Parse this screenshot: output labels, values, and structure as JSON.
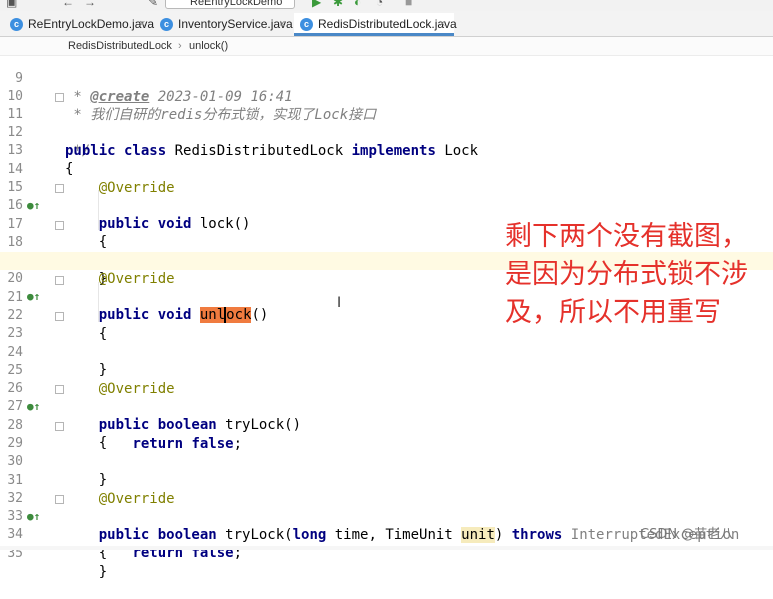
{
  "toolbar": {
    "run_config": "ReEntryLockDemo"
  },
  "tabs": [
    {
      "label": "ReEntryLockDemo.java",
      "active": false
    },
    {
      "label": "InventoryService.java",
      "active": false
    },
    {
      "label": "RedisDistributedLock.java",
      "active": true
    }
  ],
  "breadcrumb": {
    "class": "RedisDistributedLock",
    "method": "unlock()"
  },
  "annotation_note": "剩下两个没有截图，是因为分布式锁不涉及，所以不用重写",
  "watermark": "CSDN @苗老八",
  "lines": [
    {
      "n": "9",
      "text": " * @create 2023-01-09 16:41"
    },
    {
      "n": "10",
      "text": " * 我们自研的redis分布式锁，实现了Lock接口"
    },
    {
      "n": "11",
      "text": " */"
    },
    {
      "n": "12",
      "text": "public class RedisDistributedLock implements Lock"
    },
    {
      "n": "13",
      "text": "{"
    },
    {
      "n": "14",
      "text": "    @Override"
    },
    {
      "n": "15",
      "text": "    public void lock()"
    },
    {
      "n": "16",
      "text": "    {"
    },
    {
      "n": "17",
      "text": ""
    },
    {
      "n": "18",
      "text": "    }"
    },
    {
      "n": "19",
      "text": "    @Override"
    },
    {
      "n": "20",
      "text": "    public void unlock()"
    },
    {
      "n": "21",
      "text": "    {"
    },
    {
      "n": "22",
      "text": ""
    },
    {
      "n": "23",
      "text": "    }"
    },
    {
      "n": "24",
      "text": ""
    },
    {
      "n": "25",
      "text": "    @Override"
    },
    {
      "n": "26",
      "text": "    public boolean tryLock()"
    },
    {
      "n": "27",
      "text": "    {"
    },
    {
      "n": "28",
      "text": "        return false;"
    },
    {
      "n": "29",
      "text": "    }"
    },
    {
      "n": "30",
      "text": ""
    },
    {
      "n": "31",
      "text": "    @Override"
    },
    {
      "n": "32",
      "text": "    public boolean tryLock(long time, TimeUnit unit) throws InterruptedException"
    },
    {
      "n": "33",
      "text": "    {"
    },
    {
      "n": "34",
      "text": "        return false;"
    },
    {
      "n": "35",
      "text": "    }"
    }
  ]
}
